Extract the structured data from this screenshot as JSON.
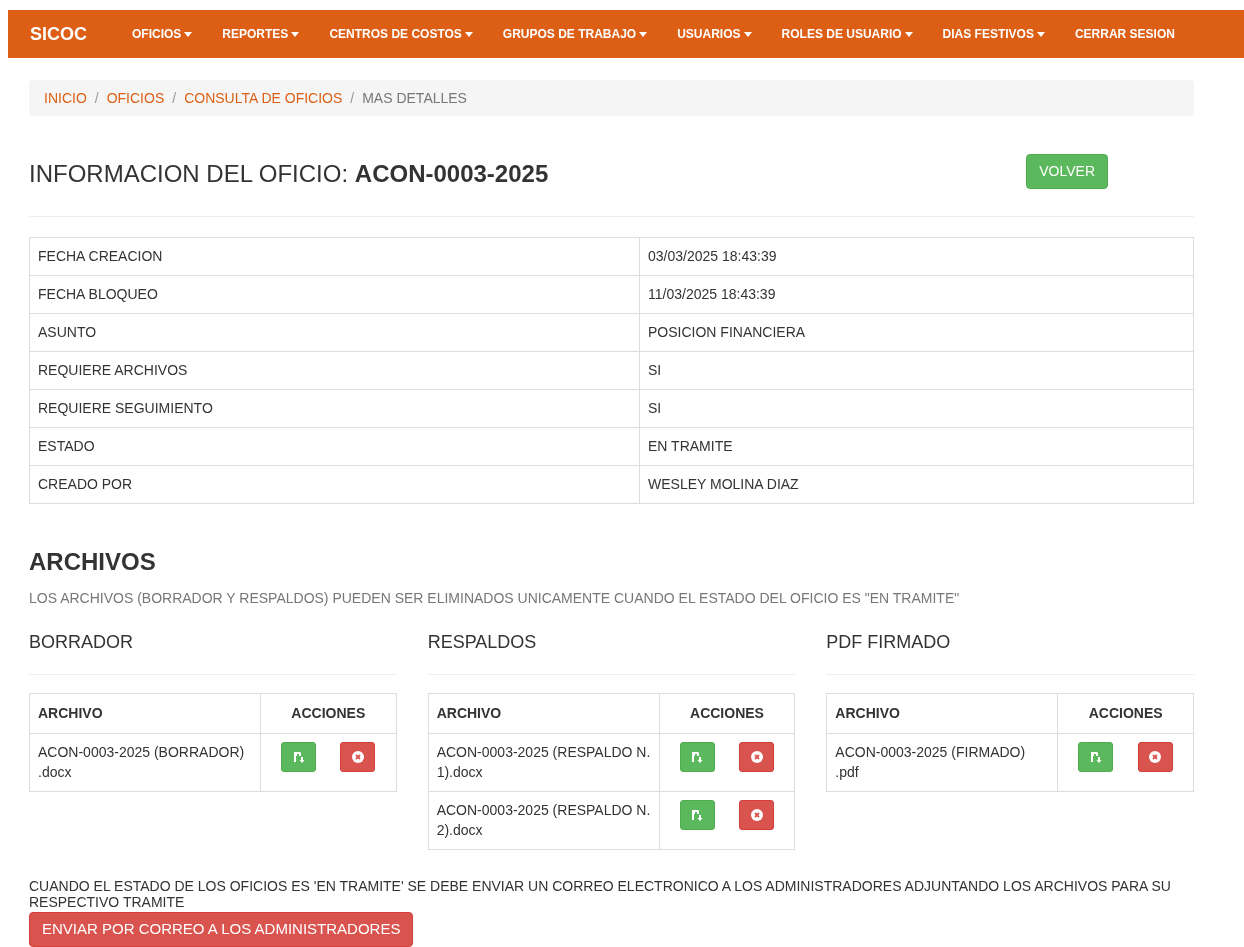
{
  "navbar": {
    "brand": "SICOC",
    "items": [
      {
        "label": "OFICIOS",
        "dropdown": true
      },
      {
        "label": "REPORTES",
        "dropdown": true
      },
      {
        "label": "CENTROS DE COSTOS",
        "dropdown": true
      },
      {
        "label": "GRUPOS DE TRABAJO",
        "dropdown": true
      },
      {
        "label": "USUARIOS",
        "dropdown": true
      },
      {
        "label": "ROLES DE USUARIO",
        "dropdown": true
      },
      {
        "label": "DIAS FESTIVOS",
        "dropdown": true
      },
      {
        "label": "CERRAR SESION",
        "dropdown": false
      }
    ]
  },
  "breadcrumb_separator": "/",
  "breadcrumb": [
    {
      "label": "INICIO",
      "link": true
    },
    {
      "label": "OFICIOS",
      "link": true
    },
    {
      "label": "CONSULTA DE OFICIOS",
      "link": true
    },
    {
      "label": "MAS DETALLES",
      "link": false
    }
  ],
  "header": {
    "title": "INFORMACION DEL OFICIO: **ACON-0003-2025**",
    "back_button": "VOLVER"
  },
  "details": [
    {
      "label": "FECHA CREACION",
      "value": "03/03/2025 18:43:39"
    },
    {
      "label": "FECHA BLOQUEO",
      "value": "11/03/2025 18:43:39"
    },
    {
      "label": "ASUNTO",
      "value": "POSICION FINANCIERA"
    },
    {
      "label": "REQUIERE ARCHIVOS",
      "value": "SI"
    },
    {
      "label": "REQUIERE SEGUIMIENTO",
      "value": "SI"
    },
    {
      "label": "ESTADO",
      "value": "EN TRAMITE"
    },
    {
      "label": "CREADO POR",
      "value": "WESLEY MOLINA DIAZ"
    }
  ],
  "files": {
    "title": "ARCHIVOS",
    "note": "LOS ARCHIVOS (BORRADOR Y RESPALDOS) PUEDEN SER ELIMINADOS UNICAMENTE CUANDO EL ESTADO DEL OFICIO ES \"EN TRAMITE\"",
    "sections": [
      {
        "title": "BORRADOR",
        "columns": [
          "ARCHIVO",
          "ACCIONES"
        ],
        "rows": [
          "ACON-0003-2025 (BORRADOR) .docx"
        ]
      },
      {
        "title": "RESPALDOS",
        "columns": [
          "ARCHIVO",
          "ACCIONES"
        ],
        "rows": [
          "ACON-0003-2025 (RESPALDO N. 1).docx",
          "ACON-0003-2025 (RESPALDO N. 2).docx"
        ]
      },
      {
        "title": "PDF FIRMADO",
        "columns": [
          "ARCHIVO",
          "ACCIONES"
        ],
        "rows": [
          "ACON-0003-2025 (FIRMADO) .pdf"
        ]
      }
    ]
  },
  "email": {
    "note": "CUANDO EL ESTADO DE LOS OFICIOS ES 'EN TRAMITE' SE DEBE ENVIAR UN CORREO ELECTRONICO A LOS ADMINISTRADORES ADJUNTANDO LOS ARCHIVOS PARA SU RESPECTIVO TRAMITE",
    "button": "ENVIAR POR CORREO A LOS ADMINISTRADORES"
  }
}
